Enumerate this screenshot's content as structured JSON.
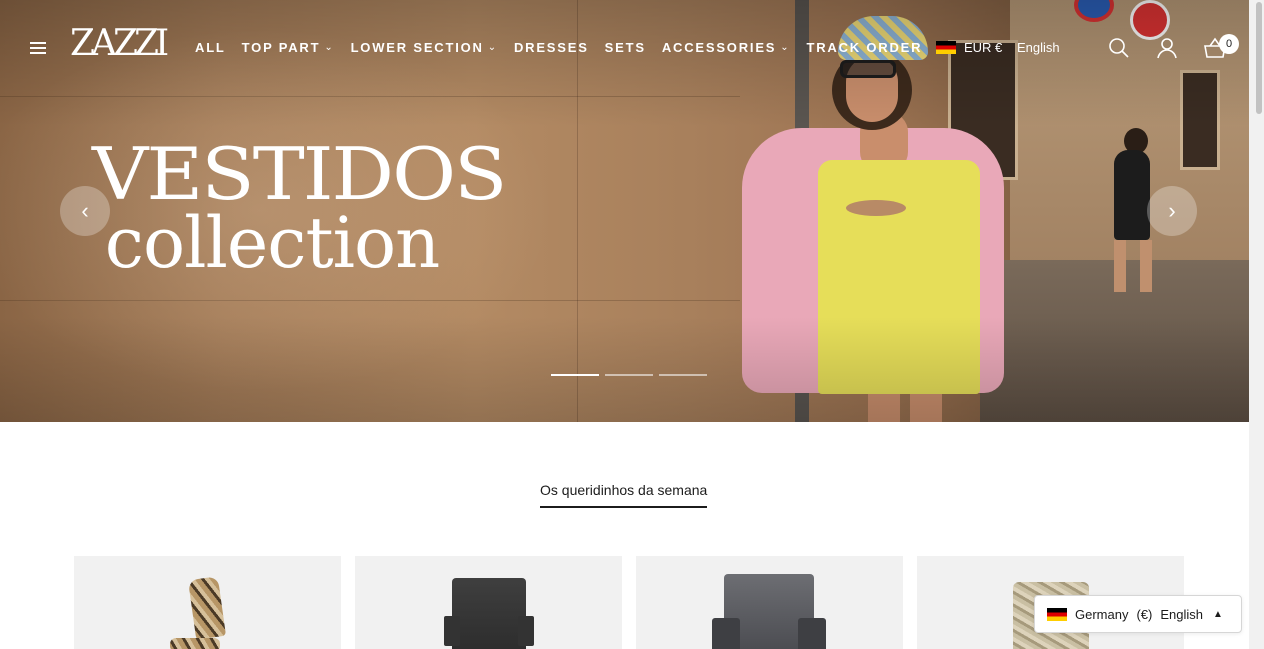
{
  "header": {
    "logo": "ZAZZI",
    "nav": [
      {
        "label": "ALL",
        "has_dropdown": false
      },
      {
        "label": "TOP PART",
        "has_dropdown": true
      },
      {
        "label": "LOWER SECTION",
        "has_dropdown": true
      },
      {
        "label": "DRESSES",
        "has_dropdown": false
      },
      {
        "label": "SETS",
        "has_dropdown": false
      },
      {
        "label": "ACCESSORIES",
        "has_dropdown": true
      },
      {
        "label": "TRACK ORDER",
        "has_dropdown": false
      }
    ],
    "currency": "EUR €",
    "language": "English",
    "cart_count": "0",
    "icons": [
      "menu-icon",
      "search-icon",
      "account-icon",
      "cart-icon"
    ]
  },
  "hero": {
    "title_line1": "VESTIDOS",
    "title_line2": "collection",
    "slides": 3,
    "active_slide": 1
  },
  "section": {
    "tab_label": "Os queridinhos da semana"
  },
  "products": [
    {
      "image": "scarf-animal-print"
    },
    {
      "image": "black-cargo-shorts"
    },
    {
      "image": "grey-denim-cargo-shorts"
    },
    {
      "image": "snake-print-pants"
    }
  ],
  "country_selector": {
    "country": "Germany",
    "currency": "(€)",
    "language": "English"
  },
  "colors": {
    "accent": "#1c1c1c",
    "card_bg": "#f1f1f1"
  }
}
